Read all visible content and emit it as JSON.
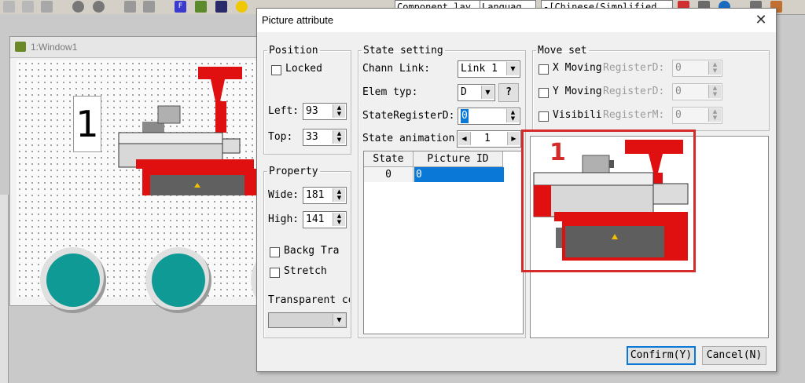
{
  "toolbar": {
    "layer_combo": "Component lay",
    "language_combo": "Languag",
    "chinese_combo": "-[Chinese(Simplified"
  },
  "window": {
    "title": "1:Window1"
  },
  "canvas": {
    "preview_digit": "1"
  },
  "dialog": {
    "title": "Picture attribute",
    "close_glyph": "✕",
    "position": {
      "legend": "Position",
      "locked_label": "Locked",
      "left_label": "Left:",
      "left_value": "93",
      "top_label": "Top:",
      "top_value": "33"
    },
    "property": {
      "legend": "Property",
      "wide_label": "Wide:",
      "wide_value": "181",
      "high_label": "High:",
      "high_value": "141",
      "backg_label": "Backg Tra",
      "stretch_label": "Stretch",
      "transparent_label": "Transparent co"
    },
    "state": {
      "legend": "State setting",
      "chann_label": "Chann Link:",
      "chann_value": "Link 1",
      "elem_label": "Elem typ:",
      "elem_value": "D",
      "help_label": "?",
      "register_label": "StateRegisterD:",
      "register_value": "0",
      "animation_label": "State animation",
      "animation_value": "1",
      "table": {
        "headers": [
          "State",
          "Picture ID"
        ],
        "rows": [
          [
            "0",
            "0"
          ]
        ]
      }
    },
    "move": {
      "legend": "Move set",
      "x_label": "X Moving",
      "x_register": "RegisterD:",
      "x_value": "0",
      "y_label": "Y Moving",
      "y_register": "RegisterD:",
      "y_value": "0",
      "vis_label": "Visibili",
      "vis_register": "RegisterM:",
      "vis_value": "0"
    },
    "preview": {
      "annotation_number": "1"
    },
    "confirm_label": "Confirm(Y)",
    "cancel_label": "Cancel(N)"
  },
  "colors": {
    "machine_red": "#e01010",
    "annotation_red": "#d42a2a",
    "teal": "#0f9a96",
    "selection_blue": "#0a78d7"
  },
  "icons": [
    "save-icon",
    "hand-icon",
    "warning-icon",
    "color-wheel-icon",
    "search-icon"
  ]
}
